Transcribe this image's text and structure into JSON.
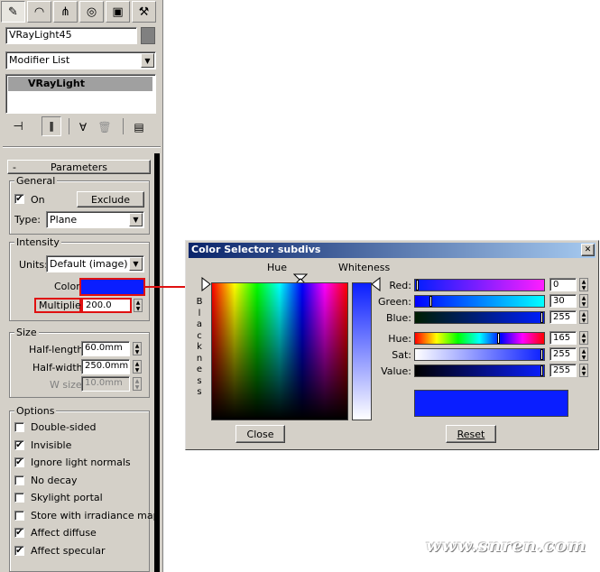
{
  "panel": {
    "object_name": "VRayLight45",
    "modifier_list": "Modifier List",
    "stack_item": "VRayLight",
    "rollout_collapse": "-",
    "rollout_title": "Parameters",
    "general": {
      "title": "General",
      "on_label": "On",
      "exclude_label": "Exclude",
      "type_label": "Type:",
      "type_value": "Plane"
    },
    "intensity": {
      "title": "Intensity",
      "units_label": "Units:",
      "units_value": "Default (image)",
      "color_label": "Color:",
      "multiplier_label": "Multiplier:",
      "multiplier_value": "200.0"
    },
    "size": {
      "title": "Size",
      "half_length_label": "Half-length:",
      "half_length_value": "60.0mm",
      "half_width_label": "Half-width:",
      "half_width_value": "250.0mm",
      "w_size_label": "W size",
      "w_size_value": "10.0mm"
    },
    "options": {
      "title": "Options",
      "items": [
        {
          "label": "Double-sided",
          "checked": false
        },
        {
          "label": "Invisible",
          "checked": true
        },
        {
          "label": "Ignore light normals",
          "checked": true
        },
        {
          "label": "No decay",
          "checked": false
        },
        {
          "label": "Skylight portal",
          "checked": false
        },
        {
          "label": "Store with irradiance map",
          "checked": false
        },
        {
          "label": "Affect diffuse",
          "checked": true
        },
        {
          "label": "Affect specular",
          "checked": true
        }
      ]
    }
  },
  "dialog": {
    "title": "Color Selector: subdivs",
    "close_x": "✕",
    "hue_label": "Hue",
    "whiteness_label": "Whiteness",
    "blackness_letters": [
      "B",
      "l",
      "a",
      "c",
      "k",
      "n",
      "e",
      "s",
      "s"
    ],
    "rgb": [
      {
        "label": "Red:",
        "value": "0"
      },
      {
        "label": "Green:",
        "value": "30"
      },
      {
        "label": "Blue:",
        "value": "255"
      }
    ],
    "hsv": [
      {
        "label": "Hue:",
        "value": "165"
      },
      {
        "label": "Sat:",
        "value": "255"
      },
      {
        "label": "Value:",
        "value": "255"
      }
    ],
    "close_button": "Close",
    "reset_button": "Reset",
    "swatch_color": "#0a1eff"
  },
  "watermark": "www.snren.com",
  "colors": {
    "selected_color": "#0a1eff",
    "highlight_red": "#e01010",
    "titlebar": "#0a246a"
  }
}
